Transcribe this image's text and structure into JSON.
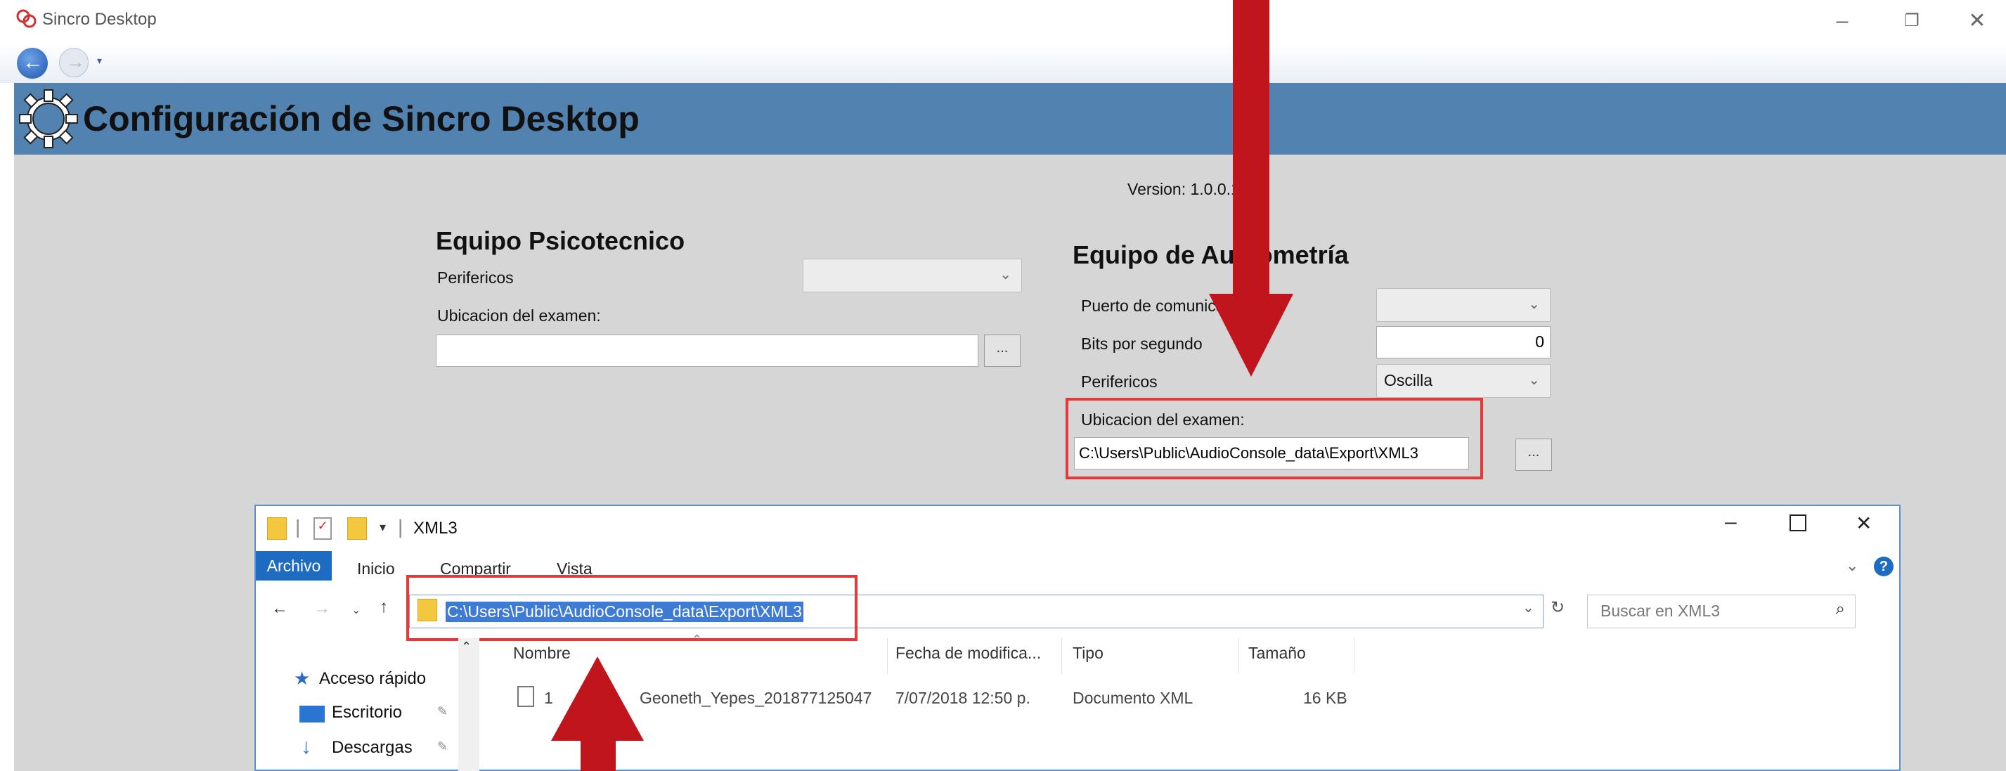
{
  "app": {
    "title": "Sincro Desktop"
  },
  "header": {
    "title": "Configuración de Sincro Desktop"
  },
  "version": "Version: 1.0.0.1",
  "psico": {
    "title": "Equipo Psicotecnico",
    "perifericos_label": "Perifericos",
    "ubicacion_label": "Ubicacion del examen:",
    "ubicacion_value": "",
    "browse_label": "..."
  },
  "audio": {
    "title": "Equipo de Audiometría",
    "puerto_label": "Puerto de comunicaciones",
    "bits_label": "Bits por segundo",
    "bits_value": "0",
    "perifericos_label": "Perifericos",
    "perifericos_value": "Oscilla",
    "ubicacion_label": "Ubicacion del examen:",
    "ubicacion_value": "C:\\Users\\Public\\AudioConsole_data\\Export\\XML3",
    "browse_label": "..."
  },
  "explorer": {
    "title": "XML3",
    "tabs": [
      "Archivo",
      "Inicio",
      "Compartir",
      "Vista"
    ],
    "address": "C:\\Users\\Public\\AudioConsole_data\\Export\\XML3",
    "search_placeholder": "Buscar en XML3",
    "columns": [
      "Nombre",
      "Fecha de modifica...",
      "Tipo",
      "Tamaño"
    ],
    "nav": [
      "Acceso rápido",
      "Escritorio",
      "Descargas"
    ],
    "rows": [
      {
        "name_prefix": "1",
        "name": "Geoneth_Yepes_201877125047",
        "date": "7/07/2018 12:50 p.",
        "type": "Documento XML",
        "size": "16 KB"
      }
    ]
  },
  "colors": {
    "header": "#5283b0",
    "highlight": "#e03a3a",
    "arrow": "#c0151c",
    "selection": "#3d7bd4"
  }
}
